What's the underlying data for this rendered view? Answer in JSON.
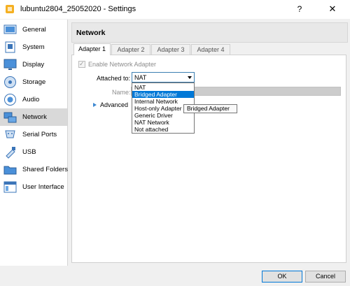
{
  "window": {
    "title": "lubuntu2804_25052020 - Settings",
    "help_label": "?",
    "close_label": "✕"
  },
  "sidebar": {
    "items": [
      {
        "label": "General",
        "icon": "general-icon"
      },
      {
        "label": "System",
        "icon": "system-icon"
      },
      {
        "label": "Display",
        "icon": "display-icon"
      },
      {
        "label": "Storage",
        "icon": "storage-icon"
      },
      {
        "label": "Audio",
        "icon": "audio-icon"
      },
      {
        "label": "Network",
        "icon": "network-icon",
        "selected": true
      },
      {
        "label": "Serial Ports",
        "icon": "serial-ports-icon"
      },
      {
        "label": "USB",
        "icon": "usb-icon"
      },
      {
        "label": "Shared Folders",
        "icon": "shared-folders-icon"
      },
      {
        "label": "User Interface",
        "icon": "user-interface-icon"
      }
    ]
  },
  "main": {
    "section_title": "Network",
    "tabs": [
      {
        "label": "Adapter 1",
        "active": true
      },
      {
        "label": "Adapter 2"
      },
      {
        "label": "Adapter 3"
      },
      {
        "label": "Adapter 4"
      }
    ],
    "enable_label": "Enable Network Adapter",
    "enable_checked": true,
    "attached_label": "Attached to:",
    "attached_value": "NAT",
    "name_label": "Name:",
    "name_value": "",
    "advanced_label": "Advanced"
  },
  "dropdown": {
    "options": [
      "NAT",
      "Bridged Adapter",
      "Internal Network",
      "Host-only Adapter",
      "Generic Driver",
      "NAT Network",
      "Not attached"
    ],
    "highlighted": "Bridged Adapter"
  },
  "tooltip": {
    "text": "Bridged Adapter"
  },
  "buttons": {
    "ok_label": "OK",
    "cancel_label": "Cancel"
  },
  "colors": {
    "selection": "#0078d7",
    "sidebar_selected": "#d9d9d9"
  }
}
